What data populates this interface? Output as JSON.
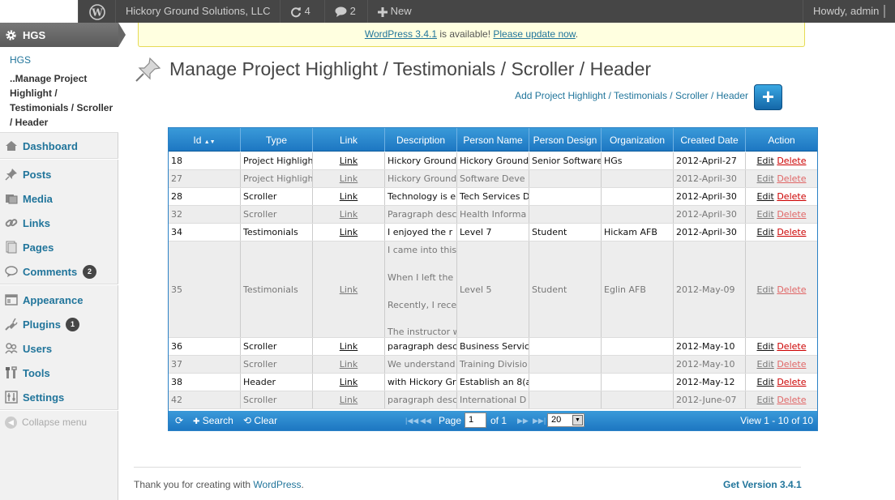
{
  "admin_bar": {
    "site_name": "Hickory Ground Solutions, LLC",
    "updates_count": "4",
    "comments_count": "2",
    "new_label": "New",
    "howdy": "Howdy, admin"
  },
  "menu": {
    "current": "HGS",
    "submenu_link": "HGS",
    "submenu_current": "..Manage Project Highlight / Testimonials / Scroller / Header",
    "items": [
      {
        "label": "Dashboard"
      },
      {
        "label": "Posts"
      },
      {
        "label": "Media"
      },
      {
        "label": "Links"
      },
      {
        "label": "Pages"
      },
      {
        "label": "Comments",
        "badge": "2"
      },
      {
        "label": "Appearance"
      },
      {
        "label": "Plugins",
        "badge": "1"
      },
      {
        "label": "Users"
      },
      {
        "label": "Tools"
      },
      {
        "label": "Settings"
      }
    ],
    "collapse": "Collapse menu"
  },
  "update_nag": {
    "version_link": "WordPress 3.4.1",
    "middle": " is available! ",
    "update_link": "Please update now",
    "end": "."
  },
  "page": {
    "title": "Manage Project Highlight / Testimonials / Scroller / Header",
    "add_link": "Add Project Highlight / Testimonials / Scroller / Header",
    "add_button": "+"
  },
  "grid": {
    "columns": [
      "Id",
      "Type",
      "Link",
      "Description",
      "Person Name",
      "Person Design",
      "Organization",
      "Created Date",
      "Action"
    ],
    "sort_indicator": "▲▼",
    "rows": [
      {
        "id": "18",
        "type": "Project Highlight",
        "link": "Link",
        "description": "Hickory Ground",
        "person_name": "Hickory Ground",
        "person_design": "Senior Software",
        "organization": "HGs",
        "date": "2012-April-27",
        "edit": "Edit",
        "delete": "Delete"
      },
      {
        "id": "27",
        "type": "Project Highlight",
        "link": "Link",
        "description": "Hickory Ground",
        "person_name": "Software Deve",
        "person_design": "",
        "organization": "",
        "date": "2012-April-30",
        "edit": "Edit",
        "delete": "Delete"
      },
      {
        "id": "28",
        "type": "Scroller",
        "link": "Link",
        "description": "Technology is e",
        "person_name": "Tech Services D",
        "person_design": "",
        "organization": "",
        "date": "2012-April-30",
        "edit": "Edit",
        "delete": "Delete"
      },
      {
        "id": "32",
        "type": "Scroller",
        "link": "Link",
        "description": "Paragraph desc",
        "person_name": "Health Informa",
        "person_design": "",
        "organization": "",
        "date": "2012-April-30",
        "edit": "Edit",
        "delete": "Delete"
      },
      {
        "id": "34",
        "type": "Testimonials",
        "link": "Link",
        "description": "I enjoyed the r",
        "person_name": "Level 7",
        "person_design": "Student",
        "organization": "Hickam AFB",
        "date": "2012-April-30",
        "edit": "Edit",
        "delete": "Delete"
      },
      {
        "id": "35",
        "type": "Testimonials",
        "link": "Link",
        "description_lines": [
          "I came into this",
          "When I left the",
          "Recently, I rece",
          "The instructor w"
        ],
        "person_name": "Level 5",
        "person_design": "Student",
        "organization": "Eglin AFB",
        "date": "2012-May-09",
        "edit": "Edit",
        "delete": "Delete"
      },
      {
        "id": "36",
        "type": "Scroller",
        "link": "Link",
        "description": "paragraph desc",
        "person_name": "Business Servic",
        "person_design": "",
        "organization": "",
        "date": "2012-May-10",
        "edit": "Edit",
        "delete": "Delete"
      },
      {
        "id": "37",
        "type": "Scroller",
        "link": "Link",
        "description": "We understand",
        "person_name": "Training Divisio",
        "person_design": "",
        "organization": "",
        "date": "2012-May-10",
        "edit": "Edit",
        "delete": "Delete"
      },
      {
        "id": "38",
        "type": "Header",
        "link": "Link",
        "description": "with Hickory Gr",
        "person_name": "Establish an 8(a",
        "person_design": "",
        "organization": "",
        "date": "2012-May-12",
        "edit": "Edit",
        "delete": "Delete"
      },
      {
        "id": "42",
        "type": "Scroller",
        "link": "Link",
        "description": "paragraph desc",
        "person_name": "International D",
        "person_design": "",
        "organization": "",
        "date": "2012-June-07",
        "edit": "Edit",
        "delete": "Delete"
      }
    ],
    "pager": {
      "search": "Search",
      "clear": "Clear",
      "page_label": "Page",
      "page_value": "1",
      "of_label": "of 1",
      "rows_value": "20",
      "view_text": "View 1 - 10 of 10"
    }
  },
  "footer": {
    "thanks_prefix": "Thank you for creating with ",
    "wp_link": "WordPress",
    "thanks_suffix": ".",
    "version": "Get Version 3.4.1"
  }
}
